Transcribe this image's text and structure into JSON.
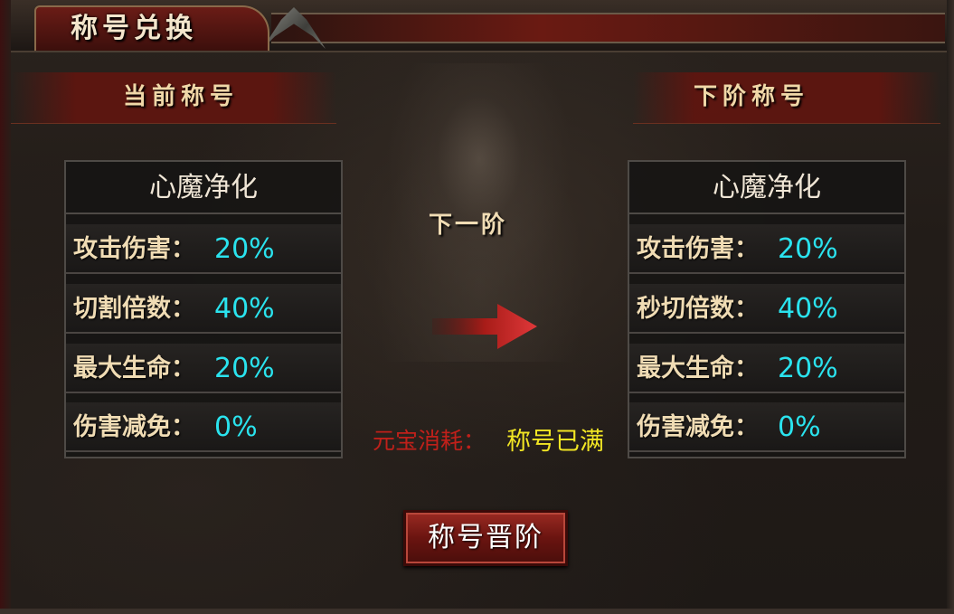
{
  "window": {
    "title": "称号兑换"
  },
  "current": {
    "header": "当前称号",
    "title_name": "心魔净化",
    "stats": [
      {
        "label": "攻击伤害：",
        "value": "20%"
      },
      {
        "label": "切割倍数：",
        "value": "40%"
      },
      {
        "label": "最大生命：",
        "value": "20%"
      },
      {
        "label": "伤害减免：",
        "value": "0%"
      }
    ]
  },
  "next": {
    "header": "下阶称号",
    "title_name": "心魔净化",
    "stats": [
      {
        "label": "攻击伤害：",
        "value": "20%"
      },
      {
        "label": "秒切倍数：",
        "value": "40%"
      },
      {
        "label": "最大生命：",
        "value": "20%"
      },
      {
        "label": "伤害减免：",
        "value": "0%"
      }
    ]
  },
  "center": {
    "next_tier_label": "下一阶",
    "arrow_icon": "right-arrow-icon"
  },
  "cost": {
    "label": "元宝消耗：",
    "value": "称号已满"
  },
  "actions": {
    "promote_label": "称号晋阶"
  },
  "colors": {
    "stat_value": "#2ae3ee",
    "stat_label": "#f0dcb4",
    "cost_label": "#c0201a",
    "cost_value": "#f2e624",
    "button_red": "#6a1410"
  }
}
